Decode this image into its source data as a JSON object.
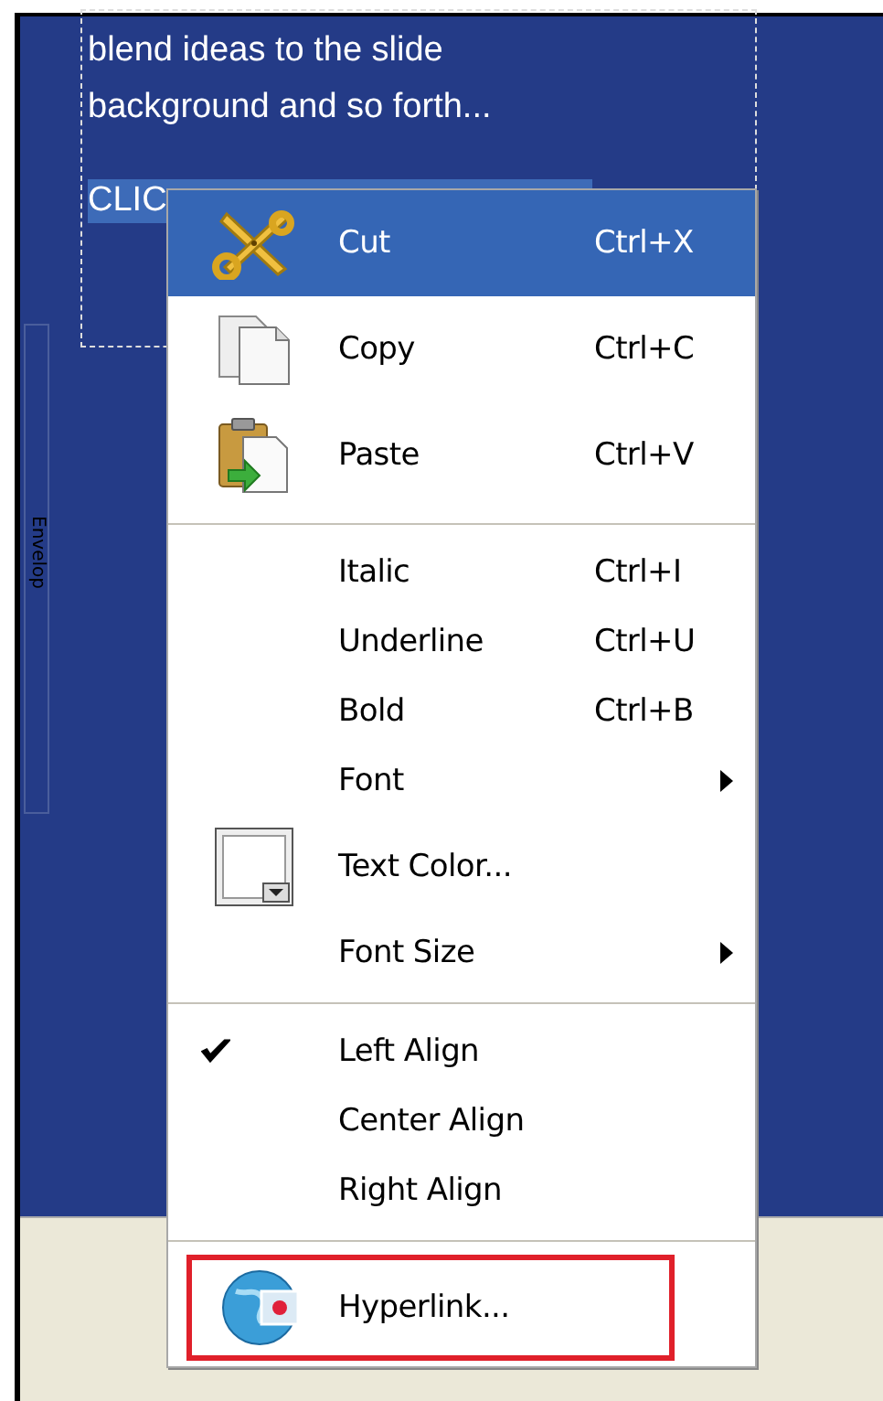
{
  "slide": {
    "text_lines": [
      "blend ideas to the slide",
      "background and so forth..."
    ],
    "selected_text": "CLIC",
    "side_label": "Envelop"
  },
  "context_menu": {
    "items": [
      {
        "kind": "command",
        "label": "Cut",
        "shortcut": "Ctrl+X",
        "selected": true,
        "checked": false,
        "outlined": false
      },
      {
        "kind": "command",
        "label": "Copy",
        "shortcut": "Ctrl+C",
        "selected": false,
        "checked": false,
        "outlined": false
      },
      {
        "kind": "command",
        "label": "Paste",
        "shortcut": "Ctrl+V",
        "selected": false,
        "checked": false,
        "outlined": false
      },
      {
        "kind": "separator"
      },
      {
        "kind": "command",
        "label": "Italic",
        "shortcut": "Ctrl+I",
        "selected": false,
        "checked": false,
        "outlined": false
      },
      {
        "kind": "command",
        "label": "Underline",
        "shortcut": "Ctrl+U",
        "selected": false,
        "checked": false,
        "outlined": false
      },
      {
        "kind": "command",
        "label": "Bold",
        "shortcut": "Ctrl+B",
        "selected": false,
        "checked": false,
        "outlined": false
      },
      {
        "kind": "submenu",
        "label": "Font",
        "selected": false,
        "checked": false,
        "outlined": false
      },
      {
        "kind": "command",
        "label": "Text Color...",
        "selected": false,
        "checked": false,
        "outlined": false
      },
      {
        "kind": "submenu",
        "label": "Font Size",
        "selected": false,
        "checked": false,
        "outlined": false
      },
      {
        "kind": "separator"
      },
      {
        "kind": "command",
        "label": "Left Align",
        "selected": false,
        "checked": true,
        "outlined": false
      },
      {
        "kind": "command",
        "label": "Center Align",
        "selected": false,
        "checked": false,
        "outlined": false
      },
      {
        "kind": "command",
        "label": "Right Align",
        "selected": false,
        "checked": false,
        "outlined": false
      },
      {
        "kind": "separator"
      },
      {
        "kind": "command",
        "label": "Hyperlink...",
        "selected": false,
        "checked": false,
        "outlined": true
      }
    ]
  }
}
